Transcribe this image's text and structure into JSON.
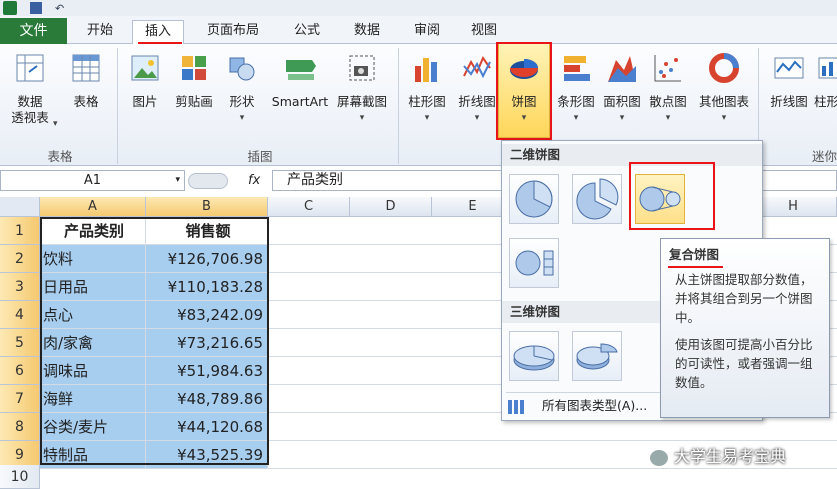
{
  "ribbon_tabs": {
    "file": "文件",
    "home": "开始",
    "insert": "插入",
    "page_layout": "页面布局",
    "formulas": "公式",
    "data": "数据",
    "review": "审阅",
    "view": "视图"
  },
  "ribbon": {
    "pivot_table": "数据\n透视表",
    "table": "表格",
    "picture": "图片",
    "clip_art": "剪贴画",
    "shapes": "形状",
    "smartart": "SmartArt",
    "screenshot": "屏幕截图",
    "column_chart": "柱形图",
    "line_chart": "折线图",
    "pie_chart": "饼图",
    "bar_chart": "条形图",
    "area_chart": "面积图",
    "scatter_chart": "散点图",
    "other_charts": "其他图表",
    "sparkline_line": "折线图",
    "sparkline_column": "柱形",
    "group_tables": "表格",
    "group_illustrations": "插图",
    "group_sparklines": "迷你"
  },
  "formula_bar": {
    "name_box": "A1",
    "fx": "fx",
    "formula": "产品类别"
  },
  "columns": [
    "A",
    "B",
    "C",
    "D",
    "E",
    "H"
  ],
  "rows": [
    "1",
    "2",
    "3",
    "4",
    "5",
    "6",
    "7",
    "8",
    "9",
    "10"
  ],
  "table": {
    "headers": [
      "产品类别",
      "销售额"
    ],
    "rows": [
      [
        "饮料",
        "¥126,706.98"
      ],
      [
        "日用品",
        "¥110,183.28"
      ],
      [
        "点心",
        "¥83,242.09"
      ],
      [
        "肉/家禽",
        "¥73,216.65"
      ],
      [
        "调味品",
        "¥51,984.63"
      ],
      [
        "海鲜",
        "¥48,789.86"
      ],
      [
        "谷类/麦片",
        "¥44,120.68"
      ],
      [
        "特制品",
        "¥43,525.39"
      ]
    ]
  },
  "dropdown": {
    "section_2d": "二维饼图",
    "section_3d": "三维饼图",
    "all_types": "所有图表类型(A)..."
  },
  "tooltip": {
    "title": "复合饼图",
    "line1": "从主饼图提取部分数值，并将其组合到另一个饼图中。",
    "line2": "使用该图可提高小百分比的可读性，或者强调一组数值。"
  },
  "watermark": "大学生易考宝典",
  "colors": {
    "file_tab": "#2a7a3a",
    "selection": "#a7cdef",
    "highlight": "#e8141a"
  }
}
